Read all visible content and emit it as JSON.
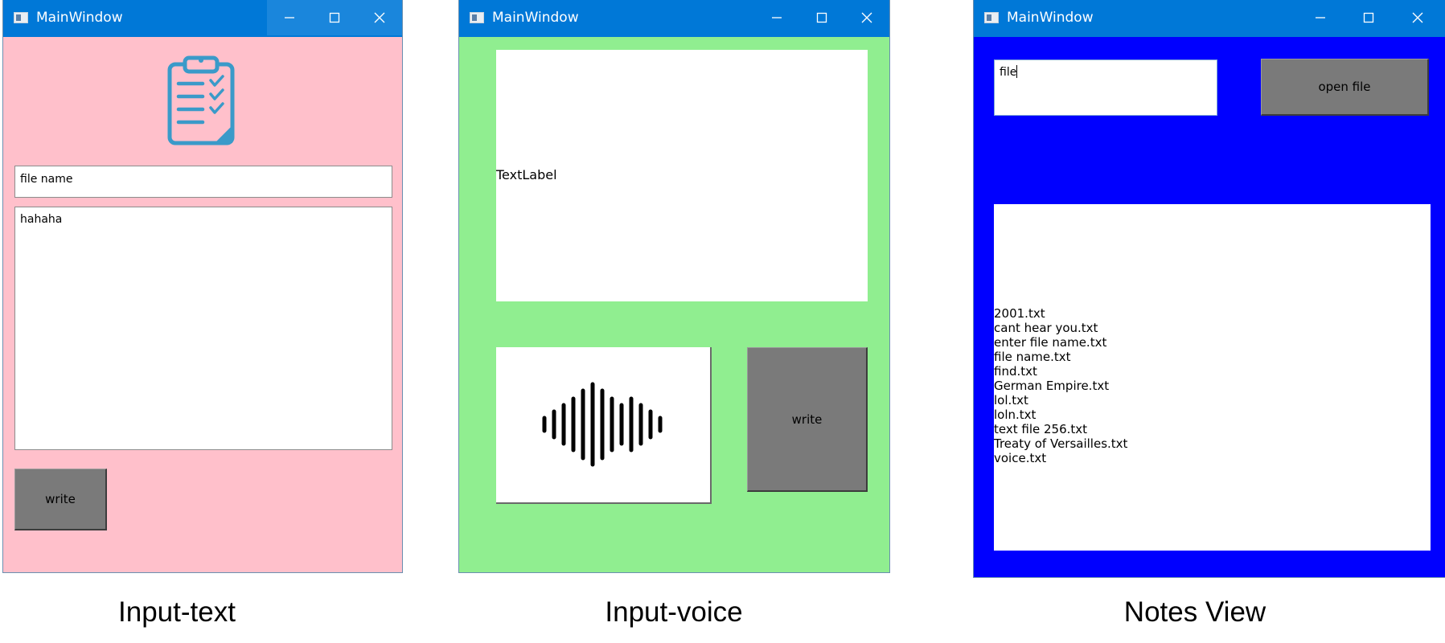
{
  "windows": {
    "input_text": {
      "title": "MainWindow",
      "colors": {
        "titlebar": "#0078d7",
        "background": "#ffc0cb"
      },
      "file_name_value": "file name",
      "text_body": "hahaha",
      "write_button": "write",
      "clipboard_icon": "clipboard-checklist-icon"
    },
    "input_voice": {
      "title": "MainWindow",
      "colors": {
        "titlebar": "#0078d7",
        "background": "#90ee90"
      },
      "text_label": "TextLabel",
      "write_button": "write",
      "waveform_icon": "sound-wave-icon"
    },
    "notes_view": {
      "title": "MainWindow",
      "colors": {
        "titlebar": "#0078d7",
        "background": "#0000ff"
      },
      "search_value": "file",
      "open_button": "open file",
      "files": [
        "2001.txt",
        "cant hear you.txt",
        "enter file name.txt",
        "file name.txt",
        "find.txt",
        "German Empire.txt",
        "lol.txt",
        "loln.txt",
        "text file 256.txt",
        "Treaty of Versailles.txt",
        "voice.txt"
      ]
    }
  },
  "captions": {
    "input_text": "Input-text",
    "input_voice": "Input-voice",
    "notes_view": "Notes View"
  }
}
